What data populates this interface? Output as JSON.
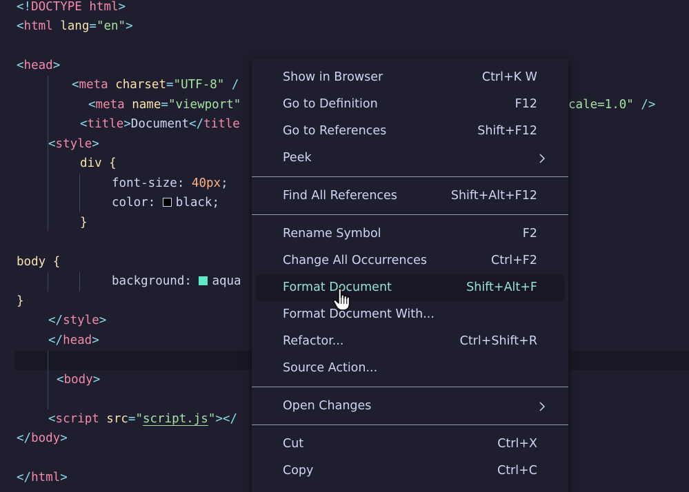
{
  "editor": {
    "lines": {
      "l1": {
        "a": "<!",
        "b": "DOCTYPE",
        "c": " html",
        "d": ">"
      },
      "l2": {
        "a": "<",
        "b": "html",
        "c": " lang",
        "d": "=",
        "e": "\"en\"",
        "f": ">"
      },
      "l4": {
        "a": "<",
        "b": "head",
        "c": ">"
      },
      "l5": {
        "a": "<",
        "b": "meta",
        "c": " charset",
        "d": "=",
        "e": "\"UTF-8\"",
        "f": " /"
      },
      "l6": {
        "a": "<",
        "b": "meta",
        "c": " name",
        "d": "=",
        "e": "\"viewport\"",
        "g": "cale=1.0\"",
        "h": " />"
      },
      "l7": {
        "a": "<",
        "b": "title",
        "c": ">",
        "d": "Document",
        "e": "</",
        "f": "title"
      },
      "l8": {
        "a": "<",
        "b": "style",
        "c": ">"
      },
      "l9": {
        "a": "div",
        "b": " {"
      },
      "l10": {
        "a": "font-size",
        "b": ": ",
        "c": "40px",
        "d": ";"
      },
      "l11": {
        "a": "color",
        "b": ": ",
        "c": "black",
        "d": ";"
      },
      "l12": {
        "a": "}"
      },
      "l14": {
        "a": "body",
        "b": " {"
      },
      "l15": {
        "a": "background",
        "b": ": ",
        "c": "aqua"
      },
      "l16": {
        "a": "}"
      },
      "l17": {
        "a": "</",
        "b": "style",
        "c": ">"
      },
      "l18": {
        "a": "</",
        "b": "head",
        "c": ">"
      },
      "l20": {
        "a": "<",
        "b": "body",
        "c": ">"
      },
      "l22": {
        "a": "<",
        "b": "script",
        "c": " src",
        "d": "=",
        "e": "\"",
        "f": "script.js",
        "g": "\"",
        "h": "></"
      },
      "l23": {
        "a": "</",
        "b": "body",
        "c": ">"
      },
      "l25": {
        "a": "</",
        "b": "html",
        "c": ">"
      }
    },
    "swatch_colors": {
      "black": "#000000",
      "aqua": "#5ee8c4"
    }
  },
  "context_menu": {
    "items": [
      {
        "label": "Show in Browser",
        "shortcut": "Ctrl+K W"
      },
      {
        "label": "Go to Definition",
        "shortcut": "F12"
      },
      {
        "label": "Go to References",
        "shortcut": "Shift+F12"
      },
      {
        "label": "Peek",
        "shortcut": ""
      },
      {
        "label": "Find All References",
        "shortcut": "Shift+Alt+F12"
      },
      {
        "label": "Rename Symbol",
        "shortcut": "F2"
      },
      {
        "label": "Change All Occurrences",
        "shortcut": "Ctrl+F2"
      },
      {
        "label": "Format Document",
        "shortcut": "Shift+Alt+F"
      },
      {
        "label": "Format Document With...",
        "shortcut": ""
      },
      {
        "label": "Refactor...",
        "shortcut": "Ctrl+Shift+R"
      },
      {
        "label": "Source Action...",
        "shortcut": ""
      },
      {
        "label": "Open Changes",
        "shortcut": ""
      },
      {
        "label": "Cut",
        "shortcut": "Ctrl+X"
      },
      {
        "label": "Copy",
        "shortcut": "Ctrl+C"
      }
    ],
    "active_item": "Format Document",
    "accent_color": "#94e2d5"
  }
}
